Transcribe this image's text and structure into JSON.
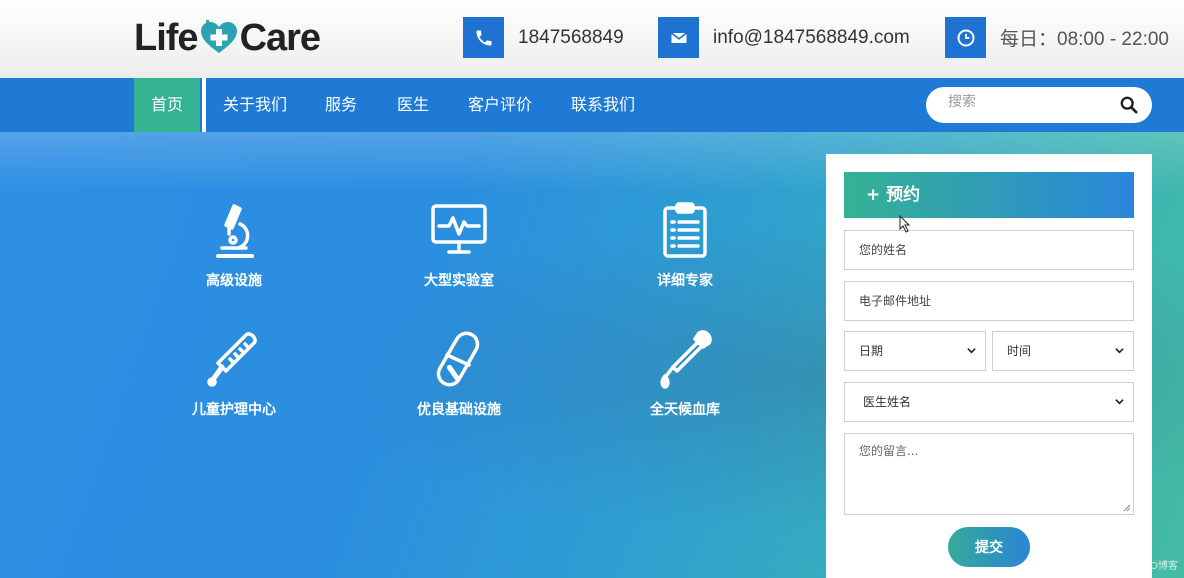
{
  "brand": {
    "logo_left": "Life",
    "logo_right": "Care"
  },
  "contacts": [
    {
      "icon": "phone-icon",
      "text": "1847568849"
    },
    {
      "icon": "envelope-icon",
      "text": "info@1847568849.com"
    },
    {
      "icon": "clock-icon",
      "text": "每日：08:00 - 22:00"
    }
  ],
  "nav": {
    "items": [
      "首页",
      "关于我们",
      "服务",
      "医生",
      "客户评价",
      "联系我们"
    ],
    "active_index": 0,
    "search_placeholder": "搜索"
  },
  "features": [
    {
      "icon": "microscope-icon",
      "label": "高级设施"
    },
    {
      "icon": "monitor-heartbeat-icon",
      "label": "大型实验室"
    },
    {
      "icon": "clipboard-icon",
      "label": "详细专家"
    },
    {
      "icon": "thermometer-icon",
      "label": "儿童护理中心"
    },
    {
      "icon": "pill-icon",
      "label": "优良基础设施"
    },
    {
      "icon": "dropper-icon",
      "label": "全天候血库"
    }
  ],
  "appointment": {
    "title": "+ 预约",
    "name_placeholder": "您的姓名",
    "email_placeholder": "电子邮件地址",
    "date_label": "日期",
    "time_label": "时间",
    "doctor_label": "医生姓名",
    "message_placeholder": "您的留言...",
    "submit_label": "提交"
  },
  "colors": {
    "primary": "#1f7ad6",
    "accent": "#33b392",
    "text": "#333333"
  },
  "watermark": "@51CTO博客"
}
